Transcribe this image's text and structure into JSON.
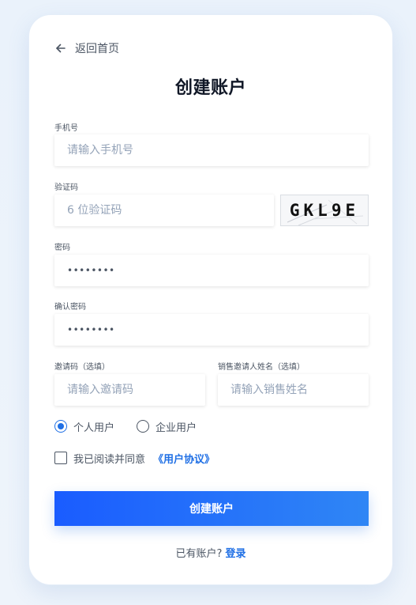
{
  "back": {
    "label": "返回首页"
  },
  "title": "创建账户",
  "phone": {
    "label": "手机号",
    "placeholder": "请输入手机号"
  },
  "code": {
    "label": "验证码",
    "placeholder": "6 位验证码",
    "captcha": "GKL9E"
  },
  "password": {
    "label": "密码",
    "value": "••••••••"
  },
  "confirm": {
    "label": "确认密码",
    "value": "••••••••"
  },
  "invite": {
    "label": "邀请码（选填）",
    "placeholder": "请输入邀请码"
  },
  "sales": {
    "label": "销售邀请人姓名（选填）",
    "placeholder": "请输入销售姓名"
  },
  "user_type": {
    "options": [
      "个人用户",
      "企业用户"
    ],
    "selected": "个人用户"
  },
  "agreement": {
    "text": "我已阅读并同意",
    "link": "《用户协议》",
    "checked": false
  },
  "submit_label": "创建账户",
  "login": {
    "text": "已有账户?",
    "link": "登录"
  },
  "colors": {
    "accent": "#1f6fe5",
    "title": "#111827",
    "text": "#4b5563",
    "placeholder": "#94a3b8"
  }
}
